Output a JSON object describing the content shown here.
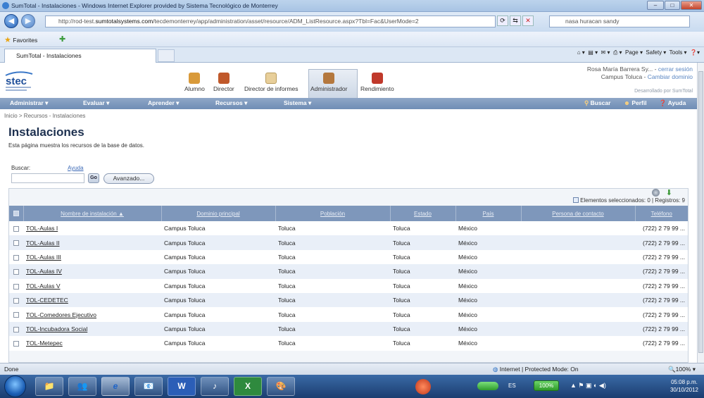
{
  "window": {
    "title": "SumTotal - Instalaciones - Windows Internet Explorer provided by Sistema Tecnológico de Monterrey",
    "controls": {
      "minimize": "–",
      "maximize": "□",
      "close": "✕"
    }
  },
  "address_bar": {
    "url_prefix": "http://rod-test.",
    "url_domain": "sumtotalsystems.com",
    "url_path": "/tecdemonterrey/app/administration/asset/resource/ADM_ListResource.aspx?Tbl=Fac&UserMode=2",
    "search_value": "nasa huracan sandy",
    "buttons": [
      "⟳",
      "⇆",
      "✕"
    ]
  },
  "favorites_bar": {
    "label": "Favorites"
  },
  "tabs": [
    {
      "label": "SumTotal - Instalaciones"
    }
  ],
  "command_bar": {
    "page": "Page ▾",
    "safety": "Safety ▾",
    "tools": "Tools ▾",
    "help": "❓▾"
  },
  "header": {
    "toolbar": [
      {
        "label": "Alumno",
        "icon": "student-icon",
        "color": "#d99a3a"
      },
      {
        "label": "Director",
        "icon": "manager-icon",
        "color": "#c0592b"
      },
      {
        "label": "Director de informes",
        "icon": "reports-icon",
        "color": "#d9b66b"
      },
      {
        "label": "Administrador",
        "icon": "admin-tools-icon",
        "color": "#b4783e",
        "selected": true
      },
      {
        "label": "Rendimiento",
        "icon": "performance-icon",
        "color": "#c0392b"
      }
    ],
    "user_name": "Rosa María Barrera Sy...",
    "logout": "cerrar sesión",
    "campus": "Campus Toluca",
    "change_domain": "Cambiar dominio",
    "developed_by": "Desarrollado por SumTotal"
  },
  "main_nav": {
    "items": [
      "Administrar ▾",
      "Evaluar ▾",
      "Aprender ▾",
      "Recursos ▾",
      "Sistema ▾"
    ],
    "right": {
      "search": "Buscar",
      "profile": "Perfil",
      "help": "Ayuda"
    }
  },
  "breadcrumb": "Inicio > Recursos - Instalaciones",
  "page_title": "Instalaciones",
  "description": "Esta página muestra los recursos de la base de datos.",
  "search": {
    "label": "Buscar:",
    "help_link": "Ayuda",
    "value": "",
    "go": "Go",
    "advanced": "Avanzado..."
  },
  "selection_info": "Elementos seleccionados: 0 | Registros: 9",
  "table": {
    "columns": [
      "Nombre de instalación ▲",
      "Dominio principal",
      "Población",
      "Estado",
      "País",
      "Persona de contacto",
      "Teléfono"
    ],
    "rows": [
      {
        "name": "TOL-Aulas I",
        "domain": "Campus Toluca",
        "city": "Toluca",
        "state": "Toluca",
        "country": "México",
        "contact": "",
        "phone": "(722) 2 79 99 ..."
      },
      {
        "name": "TOL-Aulas II",
        "domain": "Campus Toluca",
        "city": "Toluca",
        "state": "Toluca",
        "country": "México",
        "contact": "",
        "phone": "(722) 2 79 99 ..."
      },
      {
        "name": "TOL-Aulas III",
        "domain": "Campus Toluca",
        "city": "Toluca",
        "state": "Toluca",
        "country": "México",
        "contact": "",
        "phone": "(722) 2 79 99 ..."
      },
      {
        "name": "TOL-Aulas IV",
        "domain": "Campus Toluca",
        "city": "Toluca",
        "state": "Toluca",
        "country": "México",
        "contact": "",
        "phone": "(722) 2 79 99 ..."
      },
      {
        "name": "TOL-Aulas V",
        "domain": "Campus Toluca",
        "city": "Toluca",
        "state": "Toluca",
        "country": "México",
        "contact": "",
        "phone": "(722) 2 79 99 ..."
      },
      {
        "name": "TOL-CEDETEC",
        "domain": "Campus Toluca",
        "city": "Toluca",
        "state": "Toluca",
        "country": "México",
        "contact": "",
        "phone": "(722) 2 79 99 ..."
      },
      {
        "name": "TOL-Comedores Ejecutivo",
        "domain": "Campus Toluca",
        "city": "Toluca",
        "state": "Toluca",
        "country": "México",
        "contact": "",
        "phone": "(722) 2 79 99 ..."
      },
      {
        "name": "TOL-Incubadora Social",
        "domain": "Campus Toluca",
        "city": "Toluca",
        "state": "Toluca",
        "country": "México",
        "contact": "",
        "phone": "(722) 2 79 99 ..."
      },
      {
        "name": "TOL-Metepec",
        "domain": "Campus Toluca",
        "city": "Toluca",
        "state": "Toluca",
        "country": "México",
        "contact": "",
        "phone": "(722) 2 79 99 ..."
      }
    ]
  },
  "status_bar": {
    "left": "Done",
    "zone": "Internet | Protected Mode: On",
    "zoom": "100%"
  },
  "taskbar": {
    "apps": [
      "📁",
      "👥",
      "e",
      "📧",
      "W",
      "♪",
      "X",
      "🎨"
    ],
    "language": "ES",
    "battery": "100%",
    "time": "05:08 p.m.",
    "date": "30/10/2012"
  }
}
